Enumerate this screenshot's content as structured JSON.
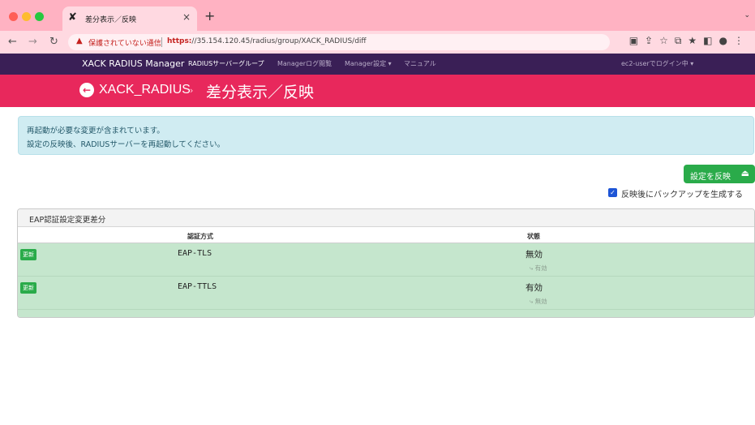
{
  "browser": {
    "tab_title": "差分表示／反映",
    "tab_close": "×",
    "new_tab": "+",
    "tab_menu": "⌄",
    "security_warning": "保護されていない通信",
    "url_scheme": "https:",
    "url_rest": "//35.154.120.45/radius/group/XACK_RADIUS/diff"
  },
  "navbar": {
    "brand": "XACK RADIUS Manager",
    "links": [
      "RADIUSサーバーグループ",
      "Managerログ閲覧",
      "Manager設定 ▾",
      "マニュアル"
    ],
    "user": "ec2-userでログイン中 ▾"
  },
  "title": {
    "group": "XACK_RADIUS",
    "separator": "›",
    "page": "差分表示／反映"
  },
  "alert": {
    "line1": "再起動が必要な変更が含まれています。",
    "line2": "設定の反映後、RADIUSサーバーを再起動してください。"
  },
  "actions": {
    "apply_label": "設定を反映",
    "backup_label": "反映後にバックアップを生成する",
    "backup_checked": true
  },
  "card": {
    "title": "EAP認証設定変更差分",
    "columns": [
      "認証方式",
      "状態"
    ],
    "rows": [
      {
        "badge": "更新",
        "method": "EAP-TLS",
        "state": "無効",
        "previous": "⤷ 有効"
      },
      {
        "badge": "更新",
        "method": "EAP-TTLS",
        "state": "有効",
        "previous": "⤷ 無効"
      }
    ]
  },
  "colors": {
    "accent": "#e8285c",
    "navbar": "#3a1f56",
    "success": "#2aab4a",
    "row_highlight": "#c5e6cd",
    "alert_bg": "#d0ecf2"
  }
}
